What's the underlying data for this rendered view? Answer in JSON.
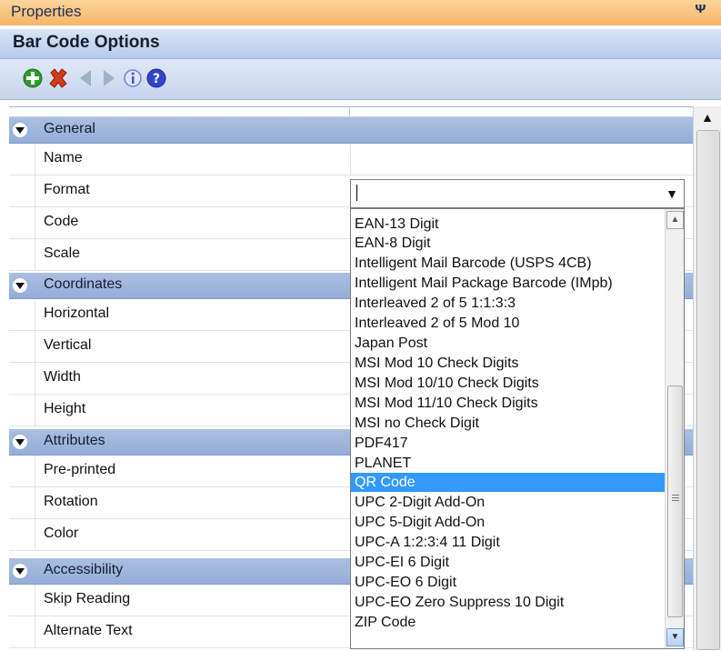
{
  "window": {
    "title": "Properties",
    "pin_glyph": "ᴪ"
  },
  "section": {
    "title": "Bar Code Options"
  },
  "toolbar": {
    "buttons": [
      {
        "icon": "add-icon",
        "color": "#2e9b2e"
      },
      {
        "icon": "delete-icon",
        "color": "#d23b1b"
      },
      {
        "icon": "back-icon",
        "color": "#9fb0cc"
      },
      {
        "icon": "forward-icon",
        "color": "#9fb0cc"
      },
      {
        "icon": "info-icon",
        "color": "#6f7fd8"
      },
      {
        "icon": "help-icon",
        "color": "#3344cc"
      }
    ]
  },
  "grid": {
    "categories": [
      {
        "label": "General",
        "rows": [
          "Name",
          "Format",
          "Code",
          "Scale"
        ]
      },
      {
        "label": "Coordinates",
        "rows": [
          "Horizontal",
          "Vertical",
          "Width",
          "Height"
        ]
      },
      {
        "label": "Attributes",
        "rows": [
          "Pre-printed",
          "Rotation",
          "Color"
        ]
      },
      {
        "label": "Accessibility",
        "rows": [
          "Skip Reading",
          "Alternate Text"
        ]
      }
    ]
  },
  "format_combo": {
    "value": "",
    "options": [
      "EAN-13 Digit",
      "EAN-8 Digit",
      "Intelligent Mail Barcode (USPS 4CB)",
      "Intelligent Mail Package Barcode (IMpb)",
      "Interleaved 2 of 5 1:1:3:3",
      "Interleaved 2 of 5 Mod 10",
      "Japan Post",
      "MSI Mod 10 Check Digits",
      "MSI Mod 10/10 Check Digits",
      "MSI Mod 11/10 Check Digits",
      "MSI no Check Digit",
      "PDF417",
      "PLANET",
      "QR Code",
      "UPC 2-Digit Add-On",
      "UPC 5-Digit Add-On",
      "UPC-A 1:2:3:4 11 Digit",
      "UPC-EI 6 Digit",
      "UPC-EO 6 Digit",
      "UPC-EO Zero Suppress 10 Digit",
      "ZIP Code"
    ],
    "selected": "QR Code"
  },
  "colors": {
    "titlebar": "#f5b566",
    "category": "#95aed8",
    "selection": "#3399ff"
  }
}
